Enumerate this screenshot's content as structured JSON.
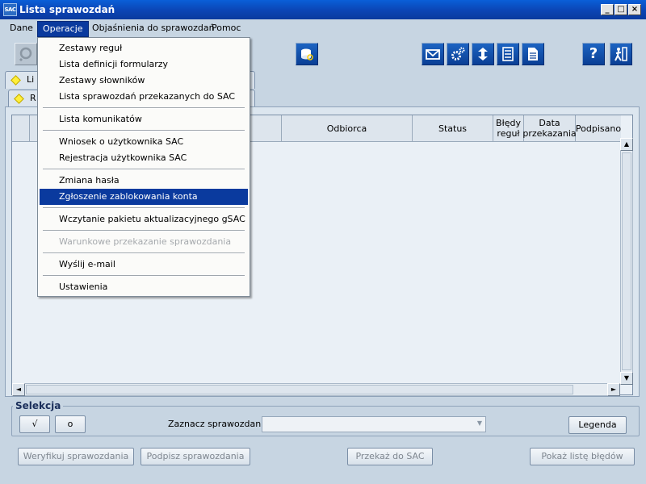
{
  "window": {
    "app_icon_text": "SAC",
    "title": "Lista sprawozdań",
    "minimize": "_",
    "maximize": "□",
    "close": "×"
  },
  "menubar": {
    "items": [
      {
        "label": "Dane"
      },
      {
        "label": "Operacje"
      },
      {
        "label": "Objaśnienia do sprawozdań"
      },
      {
        "label": "Pomoc"
      }
    ]
  },
  "toolbar": {
    "icons": [
      "report-view-icon",
      "database-search-icon",
      "mail-icon",
      "settings-icon",
      "transfer-icon",
      "list-icon",
      "document-icon",
      "help-icon",
      "exit-icon"
    ],
    "help_label": "?"
  },
  "tabs": [
    {
      "label": "Li"
    },
    {
      "label": "R"
    }
  ],
  "grid": {
    "columns": [
      "Odbiorca",
      "Status",
      "Błędy reguł",
      "Data przekazania",
      "Podpisano"
    ],
    "col_bledy_l1": "Błędy",
    "col_bledy_l2": "reguł",
    "col_data_l1": "Data",
    "col_data_l2": "przekazania"
  },
  "dropdown": {
    "items": [
      {
        "label": "Zestawy reguł",
        "state": "normal"
      },
      {
        "label": "Lista definicji formularzy",
        "state": "normal"
      },
      {
        "label": "Zestawy słowników",
        "state": "normal"
      },
      {
        "label": "Lista sprawozdań przekazanych do SAC",
        "state": "normal"
      },
      {
        "label": "Lista komunikatów",
        "state": "normal"
      },
      {
        "label": "Wniosek o użytkownika SAC",
        "state": "normal"
      },
      {
        "label": "Rejestracja użytkownika SAC",
        "state": "normal"
      },
      {
        "label": "Zmiana hasła",
        "state": "normal"
      },
      {
        "label": "Zgłoszenie zablokowania konta",
        "state": "highlighted"
      },
      {
        "label": "Wczytanie pakietu aktualizacyjnego gSAC",
        "state": "normal"
      },
      {
        "label": "Warunkowe przekazanie sprawozdania",
        "state": "disabled"
      },
      {
        "label": "Wyślij e-mail",
        "state": "normal"
      },
      {
        "label": "Ustawienia",
        "state": "normal"
      }
    ]
  },
  "selection": {
    "group_label": "Selekcja",
    "check_all": "√",
    "uncheck_all": "o",
    "mark_label": "Zaznacz sprawozdania:",
    "mark_value": "",
    "legend_button": "Legenda"
  },
  "actions": {
    "verify": "Weryfikuj sprawozdania",
    "sign": "Podpisz sprawozdania",
    "send": "Przekaż do SAC",
    "errors": "Pokaż listę błędów"
  },
  "colors": {
    "titlebar": "#0b44b4",
    "highlight": "#0a3a9e",
    "background": "#c7d5e2"
  }
}
